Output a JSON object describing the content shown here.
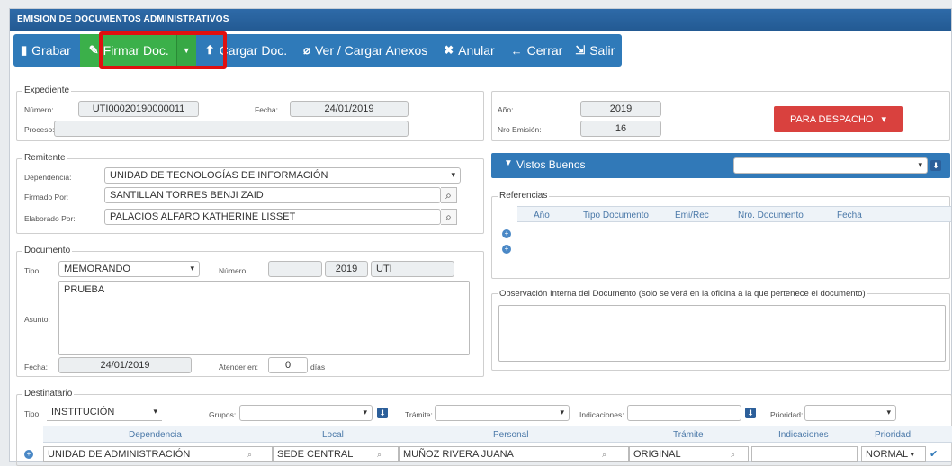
{
  "window": {
    "title": "EMISION DE DOCUMENTOS ADMINISTRATIVOS"
  },
  "toolbar": {
    "grabar": "Grabar",
    "firmar": "Firmar Doc.",
    "cargar": "Cargar Doc.",
    "anexos": "Ver / Cargar Anexos",
    "anular": "Anular",
    "cerrar": "Cerrar",
    "salir": "Salir"
  },
  "expediente": {
    "legend": "Expediente",
    "numero_label": "Número:",
    "numero": "UTI00020190000011",
    "fecha_label": "Fecha:",
    "fecha": "24/01/2019",
    "proceso_label": "Proceso:",
    "proceso": ""
  },
  "anio": {
    "label": "Año:",
    "value": "2019",
    "nro_label": "Nro Emisión:",
    "nro": "16",
    "despacho": "PARA DESPACHO"
  },
  "remitente": {
    "legend": "Remitente",
    "dep_label": "Dependencia:",
    "dep": "UNIDAD DE TECNOLOGÍAS DE INFORMACIÓN",
    "firmado_label": "Firmado Por:",
    "firmado": "SANTILLAN TORRES BENJI ZAID",
    "elaborado_label": "Elaborado Por:",
    "elaborado": "PALACIOS ALFARO KATHERINE LISSET"
  },
  "vistos": {
    "label": "Vistos Buenos",
    "value": ""
  },
  "referencias": {
    "legend": "Referencias",
    "cols": [
      "Año",
      "Tipo Documento",
      "Emi/Rec",
      "Nro. Documento",
      "Fecha"
    ]
  },
  "observacion": {
    "label": "Observación Interna del Documento (solo se verá en la oficina a la que pertenece el documento)",
    "value": ""
  },
  "documento": {
    "legend": "Documento",
    "tipo_label": "Tipo:",
    "tipo": "MEMORANDO",
    "numero_label": "Número:",
    "numero": "",
    "anio": "2019",
    "sigla": "UTI",
    "asunto_label": "Asunto:",
    "asunto": "PRUEBA",
    "fecha_label": "Fecha:",
    "fecha": "24/01/2019",
    "atender_label": "Atender en:",
    "atender": "0",
    "dias": "días"
  },
  "destinatario": {
    "legend": "Destinatario",
    "tipo_label": "Tipo:",
    "tipo": "INSTITUCIÓN",
    "grupos_label": "Grupos:",
    "tramite_label": "Trámite:",
    "indicaciones_label": "Indicaciones:",
    "prioridad_label": "Prioridad:",
    "cols": [
      "Dependencia",
      "Local",
      "Personal",
      "Trámite",
      "Indicaciones",
      "Prioridad"
    ],
    "row": {
      "dependencia": "UNIDAD DE ADMINISTRACIÓN",
      "local": "SEDE CENTRAL",
      "personal": "MUÑOZ RIVERA JUANA",
      "tramite": "ORIGINAL",
      "indicaciones": "",
      "prioridad": "NORMAL"
    }
  }
}
